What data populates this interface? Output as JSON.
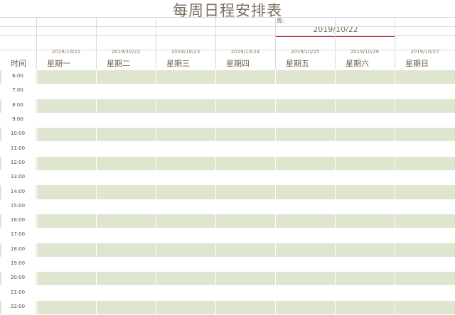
{
  "title": "每周日程安排表",
  "week": {
    "label": "周:",
    "value": "2019/10/22"
  },
  "header": {
    "time_label": "时间"
  },
  "days": [
    {
      "date": "2019/10/21",
      "name": "星期一"
    },
    {
      "date": "2019/10/22",
      "name": "星期二"
    },
    {
      "date": "2019/10/23",
      "name": "星期三"
    },
    {
      "date": "2019/10/24",
      "name": "星期四"
    },
    {
      "date": "2019/10/25",
      "name": "星期五"
    },
    {
      "date": "2019/10/26",
      "name": "星期六"
    },
    {
      "date": "2019/10/27",
      "name": "星期日"
    }
  ],
  "times": [
    "6:00",
    "7:00",
    "8:00",
    "9:00",
    "10:00",
    "11:00",
    "12:00",
    "13:00",
    "14:00",
    "15:00",
    "16:00",
    "17:00",
    "18:00",
    "19:00",
    "20:00",
    "21:00",
    "22:00"
  ],
  "colors": {
    "shade": "#dfe6cf",
    "accent": "#b23a3a",
    "title": "#7b6f5c"
  }
}
